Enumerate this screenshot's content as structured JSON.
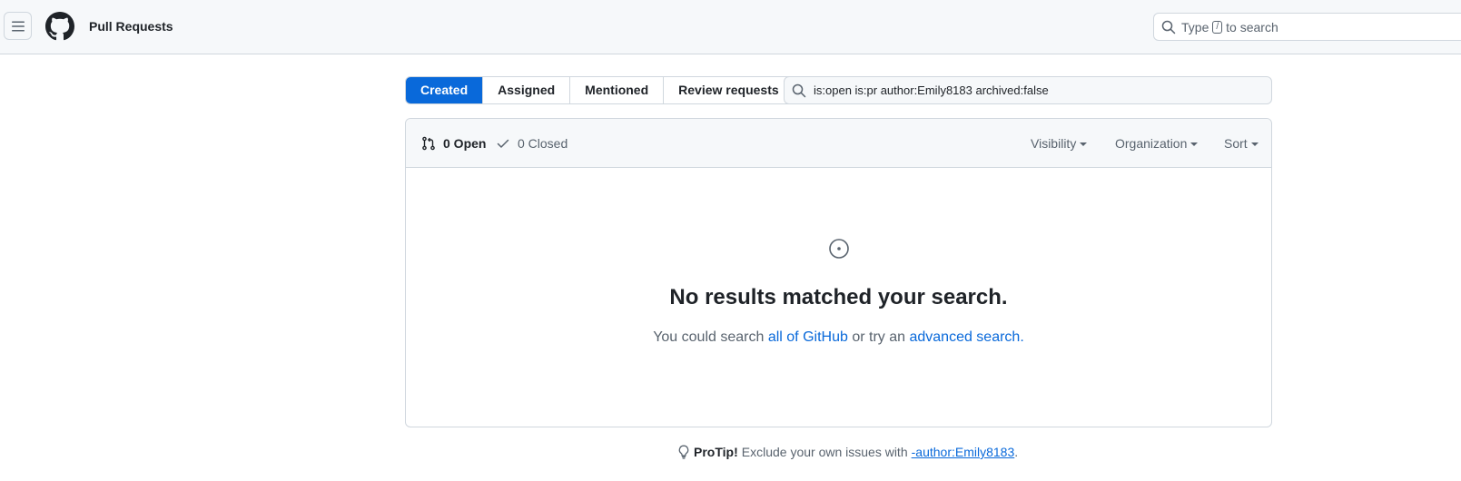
{
  "header": {
    "title": "Pull Requests",
    "search": {
      "prefix": "Type",
      "key": "/",
      "suffix": "to search"
    }
  },
  "tabs": [
    {
      "label": "Created",
      "selected": true
    },
    {
      "label": "Assigned",
      "selected": false
    },
    {
      "label": "Mentioned",
      "selected": false
    },
    {
      "label": "Review requests",
      "selected": false
    }
  ],
  "filter": {
    "value": "is:open is:pr author:Emily8183 archived:false"
  },
  "states": {
    "open_label": "0 Open",
    "closed_label": "0 Closed"
  },
  "filters_dropdowns": {
    "visibility": "Visibility",
    "organization": "Organization",
    "sort": "Sort"
  },
  "blankslate": {
    "title": "No results matched your search.",
    "text_prefix": "You could search",
    "link_all": "all of GitHub",
    "text_middle": "or try an",
    "link_advanced": "advanced search",
    "text_suffix": "."
  },
  "protip": {
    "label": "ProTip!",
    "text": "Exclude your own issues with",
    "link": "-author:Emily8183",
    "suffix": "."
  },
  "colors": {
    "accent": "#0969da",
    "header_bg": "#f6f8fa",
    "border": "#d0d7de"
  }
}
